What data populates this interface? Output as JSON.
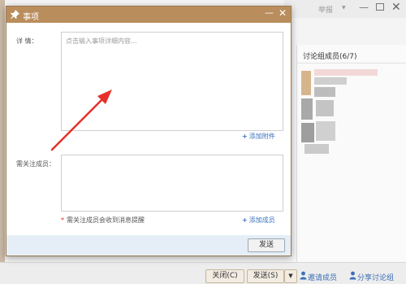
{
  "background_window": {
    "report_label": "举报",
    "dropdown_glyph": "▼",
    "minimize_glyph": "—",
    "close_glyph": "✕",
    "members_title": "讨论组成员(6/7)",
    "bottom_bar": {
      "close_label": "关闭(C)",
      "send_label": "发送(S)",
      "send_dropdown_glyph": "▼",
      "member_link": "邀请成员",
      "discussion_link": "分享讨论组"
    }
  },
  "dialog": {
    "title": "事项",
    "minimize_glyph": "—",
    "close_glyph": "✕",
    "detail_label": "详    情：",
    "detail_placeholder": "点击输入事项详细内容...",
    "add_attachment": "添加附件",
    "follow_label": "需关注成员：",
    "follow_note_star": "*",
    "follow_note": "需关注成员会收到消息提醒",
    "add_member": "添加成员",
    "plus_glyph": "+",
    "send_label": "发送"
  },
  "colors": {
    "dialog_title_bar": "#b98d5c",
    "link_blue": "#3a73bd",
    "annotation_arrow": "#e8302a",
    "dialog_footer": "#e5eef6"
  }
}
